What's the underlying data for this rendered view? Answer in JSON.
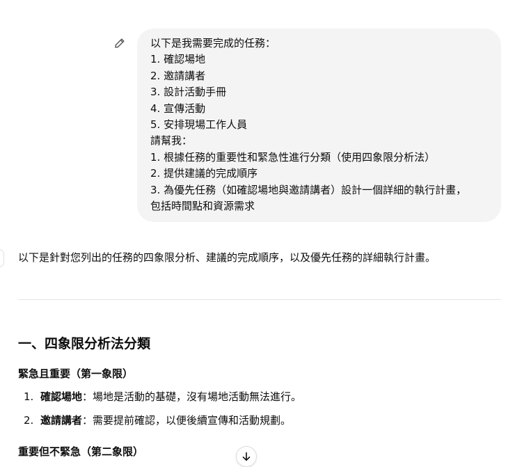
{
  "user_message": {
    "lines": [
      "以下是我需要完成的任務：",
      "1. 確認場地",
      "2. 邀請講者",
      "3. 設計活動手冊",
      "4. 宣傳活動",
      "5. 安排現場工作人員",
      "請幫我：",
      "1. 根據任務的重要性和緊急性進行分類（使用四象限分析法）",
      "2. 提供建議的完成順序",
      "3. 為優先任務（如確認場地與邀請講者）設計一個詳細的執行計畫，",
      "包括時間點和資源需求"
    ],
    "edit_icon": "pencil-icon"
  },
  "response": {
    "intro": "以下是針對您列出的任務的四象限分析、建議的完成順序，以及優先任務的詳細執行計畫。",
    "section_title": "一、四象限分析法分類",
    "quadrant1": {
      "title": "緊急且重要（第一象限）",
      "items": [
        {
          "num": "1.",
          "label": "確認場地",
          "desc": "：場地是活動的基礎，沒有場地活動無法進行。"
        },
        {
          "num": "2.",
          "label": "邀請講者",
          "desc": "：需要提前確認，以便後續宣傳和活動規劃。"
        }
      ]
    },
    "quadrant2": {
      "title": "重要但不緊急（第二象限）"
    }
  },
  "scroll_button": {
    "icon": "arrow-down-icon"
  },
  "colors": {
    "bubble_bg": "#f4f4f4",
    "text": "#0d0d0d",
    "divider": "#e5e5e5"
  }
}
